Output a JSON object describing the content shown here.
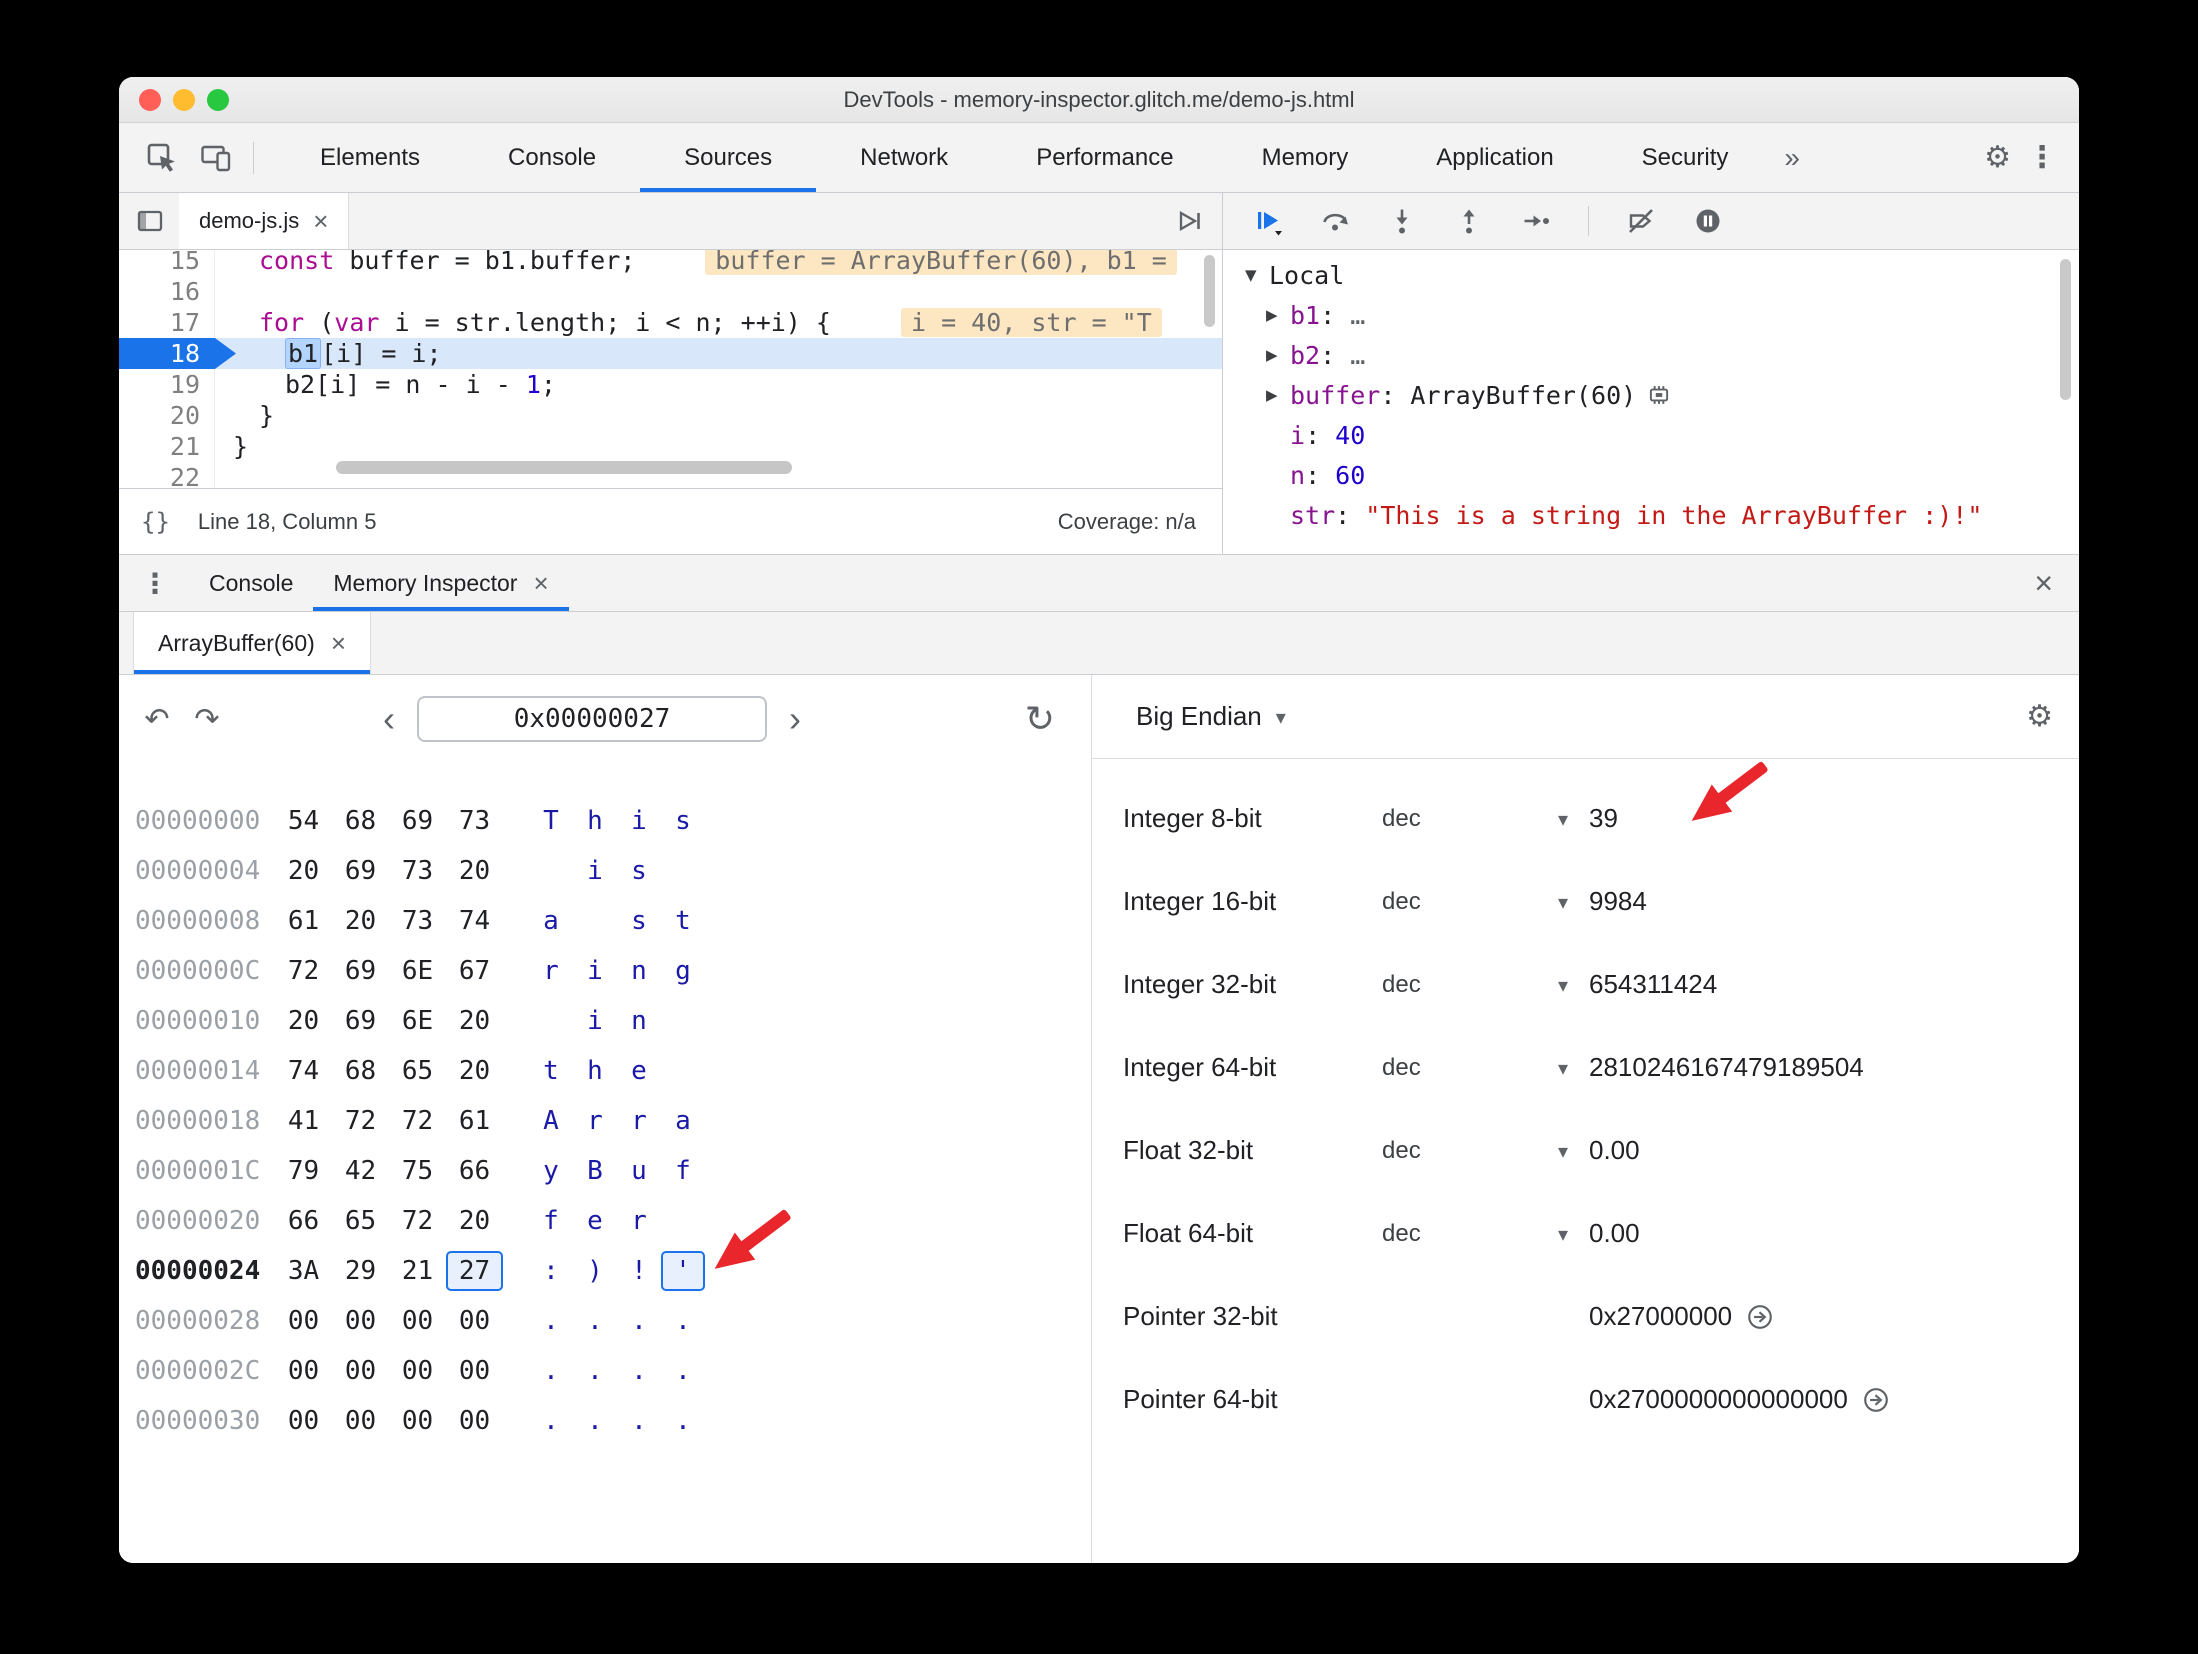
{
  "colors": {
    "accent_blue": "#1a73e8",
    "arrow_red": "#e8262b",
    "ascii_blue": "#1a1aa6",
    "traffic_red": "#ff5f57",
    "traffic_yellow": "#febc2e",
    "traffic_green": "#28c840"
  },
  "icons": {
    "close": "×",
    "gear": "⚙",
    "kebab": "⋮",
    "braces": "{}",
    "undo": "↶",
    "redo": "↷",
    "refresh": "↻",
    "chevron_left": "‹",
    "chevron_right": "›",
    "caret_down": "▾",
    "collapsed": "▶",
    "expanded": "▼"
  },
  "window": {
    "title": "DevTools - memory-inspector.glitch.me/demo-js.html"
  },
  "toolbar": {
    "tabs": [
      "Elements",
      "Console",
      "Sources",
      "Network",
      "Performance",
      "Memory",
      "Application",
      "Security"
    ],
    "selected_tab": "Sources",
    "more_label": "»"
  },
  "sources": {
    "file_tab_label": "demo-js.js",
    "status_line": "Line 18, Column 5",
    "coverage": "Coverage: n/a"
  },
  "syntax": {
    "kw": "#aa0d91",
    "num": "#1c00cf",
    "str": "#c41a16",
    "pl": "#202124",
    "hl": "#202124"
  },
  "code_lines": [
    {
      "num": "15",
      "indent": 1,
      "tokens": [
        {
          "t": "const",
          "c": "kw"
        },
        {
          "t": " buffer = b1.buffer;",
          "c": "pl"
        }
      ],
      "annotation": "buffer = ArrayBuffer(60), b1 ="
    },
    {
      "num": "16",
      "indent": 0,
      "tokens": []
    },
    {
      "num": "17",
      "indent": 1,
      "tokens": [
        {
          "t": "for",
          "c": "kw"
        },
        {
          "t": " (",
          "c": "pl"
        },
        {
          "t": "var",
          "c": "kw"
        },
        {
          "t": " i = str.length; i < n; ++i) {",
          "c": "pl"
        }
      ],
      "annotation": "i = 40, str = \"T"
    },
    {
      "num": "18",
      "indent": 2,
      "current": true,
      "tokens": [
        {
          "t": "b1",
          "c": "hl"
        },
        {
          "t": "[i] = i;",
          "c": "pl"
        }
      ]
    },
    {
      "num": "19",
      "indent": 2,
      "tokens": [
        {
          "t": "b2[i] = n - i - ",
          "c": "pl"
        },
        {
          "t": "1",
          "c": "num"
        },
        {
          "t": ";",
          "c": "pl"
        }
      ]
    },
    {
      "num": "20",
      "indent": 1,
      "tokens": [
        {
          "t": "}",
          "c": "pl"
        }
      ]
    },
    {
      "num": "21",
      "indent": 0,
      "tokens": [
        {
          "t": "}",
          "c": "pl"
        }
      ]
    },
    {
      "num": "22",
      "indent": 0,
      "tokens": []
    }
  ],
  "debugger": {
    "scope_title": "Local",
    "value_colors": {
      "dim": "#5f6368",
      "obj": "#202124",
      "num": "#1c00cf",
      "str": "#c41a16"
    },
    "entries": [
      {
        "expand": true,
        "name": "b1",
        "value": "…",
        "vclass": "dim"
      },
      {
        "expand": true,
        "name": "b2",
        "value": "…",
        "vclass": "dim"
      },
      {
        "expand": true,
        "name": "buffer",
        "value": "ArrayBuffer(60)",
        "vclass": "obj",
        "memory_icon": true
      },
      {
        "expand": false,
        "name": "i",
        "value": "40",
        "vclass": "num"
      },
      {
        "expand": false,
        "name": "n",
        "value": "60",
        "vclass": "num"
      },
      {
        "expand": false,
        "name": "str",
        "value": "\"This is a string in the ArrayBuffer :)!\"",
        "vclass": "str"
      }
    ]
  },
  "drawer": {
    "tabs": [
      "Console",
      "Memory Inspector"
    ],
    "selected": "Memory Inspector"
  },
  "memory_inspector": {
    "tab_label": "ArrayBuffer(60)",
    "address_value": "0x00000027",
    "endianness": "Big Endian",
    "rows": [
      {
        "addr": "00000000",
        "bytes": [
          "54",
          "68",
          "69",
          "73"
        ],
        "ascii": [
          "T",
          "h",
          "i",
          "s"
        ]
      },
      {
        "addr": "00000004",
        "bytes": [
          "20",
          "69",
          "73",
          "20"
        ],
        "ascii": [
          " ",
          "i",
          "s",
          " "
        ]
      },
      {
        "addr": "00000008",
        "bytes": [
          "61",
          "20",
          "73",
          "74"
        ],
        "ascii": [
          "a",
          " ",
          "s",
          "t"
        ]
      },
      {
        "addr": "0000000C",
        "bytes": [
          "72",
          "69",
          "6E",
          "67"
        ],
        "ascii": [
          "r",
          "i",
          "n",
          "g"
        ]
      },
      {
        "addr": "00000010",
        "bytes": [
          "20",
          "69",
          "6E",
          "20"
        ],
        "ascii": [
          " ",
          "i",
          "n",
          " "
        ]
      },
      {
        "addr": "00000014",
        "bytes": [
          "74",
          "68",
          "65",
          "20"
        ],
        "ascii": [
          "t",
          "h",
          "e",
          " "
        ]
      },
      {
        "addr": "00000018",
        "bytes": [
          "41",
          "72",
          "72",
          "61"
        ],
        "ascii": [
          "A",
          "r",
          "r",
          "a"
        ]
      },
      {
        "addr": "0000001C",
        "bytes": [
          "79",
          "42",
          "75",
          "66"
        ],
        "ascii": [
          "y",
          "B",
          "u",
          "f"
        ]
      },
      {
        "addr": "00000020",
        "bytes": [
          "66",
          "65",
          "72",
          "20"
        ],
        "ascii": [
          "f",
          "e",
          "r",
          " "
        ]
      },
      {
        "addr": "00000024",
        "bytes": [
          "3A",
          "29",
          "21",
          "27"
        ],
        "ascii": [
          ":",
          ")",
          "!",
          "'"
        ],
        "current": true,
        "selected_index": 3
      },
      {
        "addr": "00000028",
        "bytes": [
          "00",
          "00",
          "00",
          "00"
        ],
        "ascii": [
          ".",
          ".",
          ".",
          "."
        ]
      },
      {
        "addr": "0000002C",
        "bytes": [
          "00",
          "00",
          "00",
          "00"
        ],
        "ascii": [
          ".",
          ".",
          ".",
          "."
        ]
      },
      {
        "addr": "00000030",
        "bytes": [
          "00",
          "00",
          "00",
          "00"
        ],
        "ascii": [
          ".",
          ".",
          ".",
          "."
        ]
      }
    ],
    "interpreter_rows": [
      {
        "label": "Integer 8-bit",
        "mode": "dec",
        "value": "39"
      },
      {
        "label": "Integer 16-bit",
        "mode": "dec",
        "value": "9984"
      },
      {
        "label": "Integer 32-bit",
        "mode": "dec",
        "value": "654311424"
      },
      {
        "label": "Integer 64-bit",
        "mode": "dec",
        "value": "2810246167479189504"
      },
      {
        "label": "Float 32-bit",
        "mode": "dec",
        "value": "0.00"
      },
      {
        "label": "Float 64-bit",
        "mode": "dec",
        "value": "0.00"
      },
      {
        "label": "Pointer 32-bit",
        "value": "0x27000000",
        "jump": true
      },
      {
        "label": "Pointer 64-bit",
        "value": "0x2700000000000000",
        "jump": true
      }
    ]
  }
}
